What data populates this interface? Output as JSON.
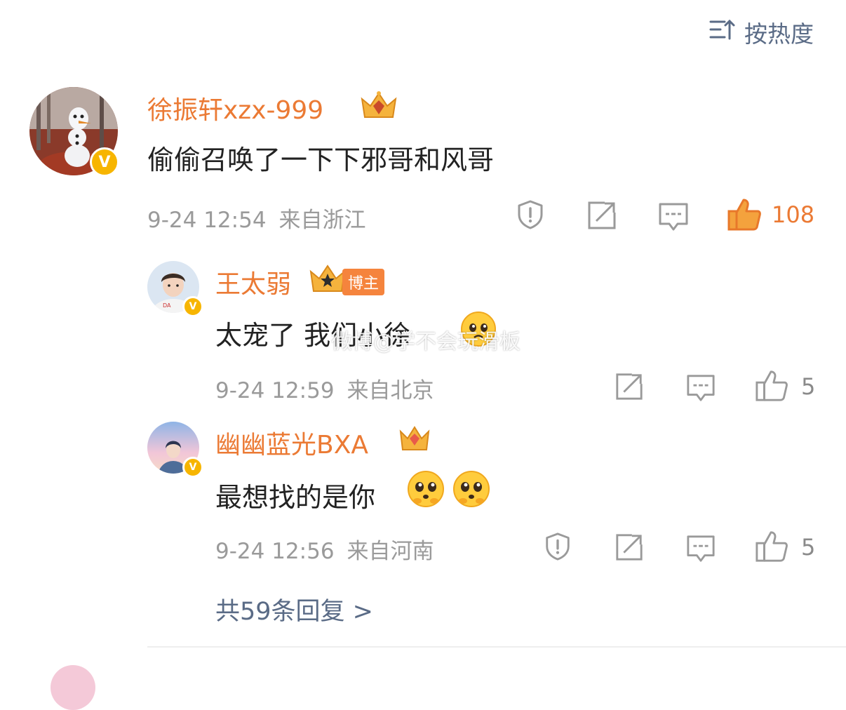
{
  "sort": {
    "label": "按热度",
    "icon": "sort-icon"
  },
  "comment": {
    "username": "徐振轩xzx-999",
    "text": "偷偷召唤了一下下邪哥和风哥",
    "date": "9-24 12:54",
    "location": "来自浙江",
    "likes": "108",
    "badge": "V"
  },
  "replies": [
    {
      "username": "王太弱",
      "tag": "博主",
      "text": "太宠了  我们小徐",
      "date": "9-24 12:59",
      "location": "来自北京",
      "likes": "5",
      "badge": "V"
    },
    {
      "username": "幽幽蓝光BXA",
      "text": "最想找的是你",
      "date": "9-24 12:56",
      "location": "来自河南",
      "likes": "5",
      "badge": "V"
    }
  ],
  "more_replies": "共59条回复 >",
  "watermark": "微博@学不会玩滑板",
  "colors": {
    "username": "#eb7a34",
    "link": "#5a6b86",
    "meta": "#9a9a9a",
    "badge": "#f7b500"
  }
}
